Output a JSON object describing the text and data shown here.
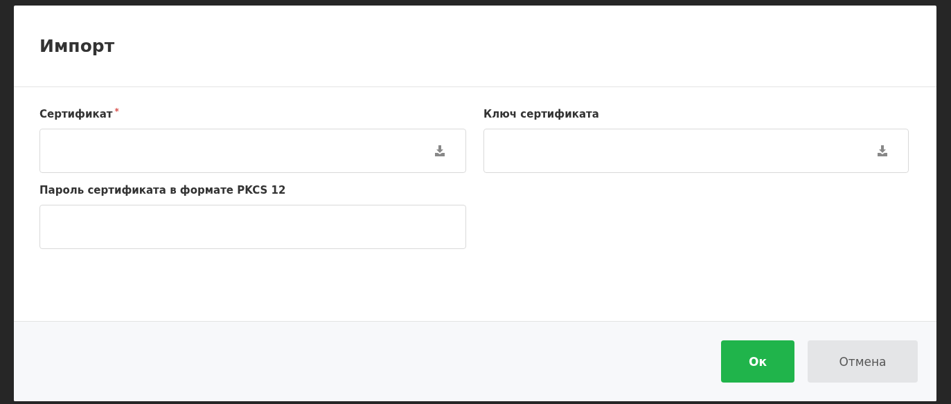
{
  "dialog": {
    "title": "Импорт",
    "fields": [
      {
        "label": "Сертификат",
        "required_mark": "*",
        "kind": "file"
      },
      {
        "label": "Ключ сертификата",
        "kind": "file"
      },
      {
        "label": "Пароль сертификата в формате PKCS 12",
        "kind": "text"
      }
    ],
    "buttons": [
      {
        "label": "Ок",
        "kind": "primary"
      },
      {
        "label": "Отмена",
        "kind": "secondary"
      }
    ]
  }
}
